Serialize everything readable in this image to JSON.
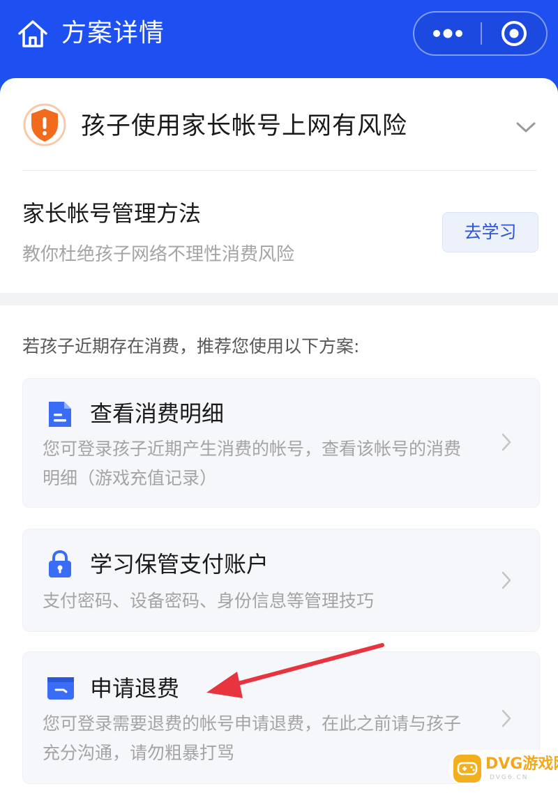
{
  "header": {
    "title": "方案详情",
    "home_icon": "home-icon",
    "more_icon": "more-dots-icon",
    "close_icon": "mini-program-close-icon",
    "background_color": "#1e4ff0"
  },
  "risk": {
    "title": "孩子使用家长帐号上网有风险",
    "icon": "warning-shield-icon",
    "expand_icon": "chevron-down-icon"
  },
  "manage": {
    "title": "家长帐号管理方法",
    "subtitle": "教你杜绝孩子网络不理性消费风险",
    "button_label": "去学习"
  },
  "recommend_text": "若孩子近期存在消费，推荐您使用以下方案:",
  "cards": [
    {
      "title": "查看消费明细",
      "icon": "document-icon",
      "desc_line1": "您可登录孩子近期产生消费的帐号，查看该帐号的消费",
      "desc_line2": "明细（游戏充值记录）"
    },
    {
      "title": "学习保管支付账户",
      "icon": "lock-icon",
      "desc_line1": "支付密码、设备密码、身份信息等管理技巧"
    },
    {
      "title": "申请退费",
      "icon": "wallet-refund-icon",
      "desc_line1": "您可登录需要退费的帐号申请退费，在此之前请与孩子",
      "desc_line2": "充分沟通，请勿粗暴打骂"
    }
  ],
  "watermark": {
    "text": "DVG游戏网",
    "sub": "DVG6.CN"
  },
  "colors": {
    "accent_blue": "#1e4ff0",
    "icon_blue": "#3b6cf5",
    "warning_orange": "#f26b1d",
    "annotation_red": "#e8343e"
  }
}
